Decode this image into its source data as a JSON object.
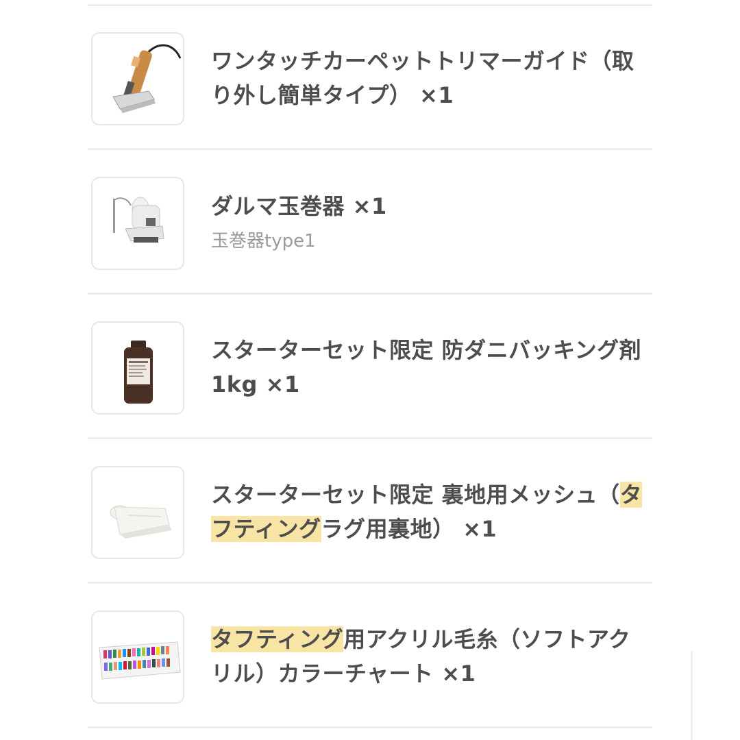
{
  "items": [
    {
      "title_parts": [
        {
          "text": "ワンタッチカーペットトリマーガイド（取り外し簡単タイプ） ×1",
          "highlight": false
        }
      ],
      "variant": "",
      "icon": "carpet-trimmer-image"
    },
    {
      "title_parts": [
        {
          "text": "ダルマ玉巻器 ×1",
          "highlight": false
        }
      ],
      "variant": "玉巻器type1",
      "icon": "yarn-winder-image"
    },
    {
      "title_parts": [
        {
          "text": "スターターセット限定 防ダニバッキング剤 1kg ×1",
          "highlight": false
        }
      ],
      "variant": "",
      "icon": "backing-glue-bottle-image"
    },
    {
      "title_parts": [
        {
          "text": "スターターセット限定 裏地用メッシュ（",
          "highlight": false
        },
        {
          "text": "タフティング",
          "highlight": true
        },
        {
          "text": "ラグ用裏地） ×1",
          "highlight": false
        }
      ],
      "variant": "",
      "icon": "mesh-fabric-image"
    },
    {
      "title_parts": [
        {
          "text": "タフティング",
          "highlight": true
        },
        {
          "text": "用アクリル毛糸（ソフトアクリル）カラーチャート ×1",
          "highlight": false
        }
      ],
      "variant": "",
      "icon": "yarn-color-chart-image"
    }
  ],
  "colors": {
    "highlight": "#f8e4a4",
    "title_text": "#4d4d4d",
    "variant_text": "#9a9a9a",
    "divider": "#ececec",
    "thumb_border": "#e6e6e6"
  }
}
